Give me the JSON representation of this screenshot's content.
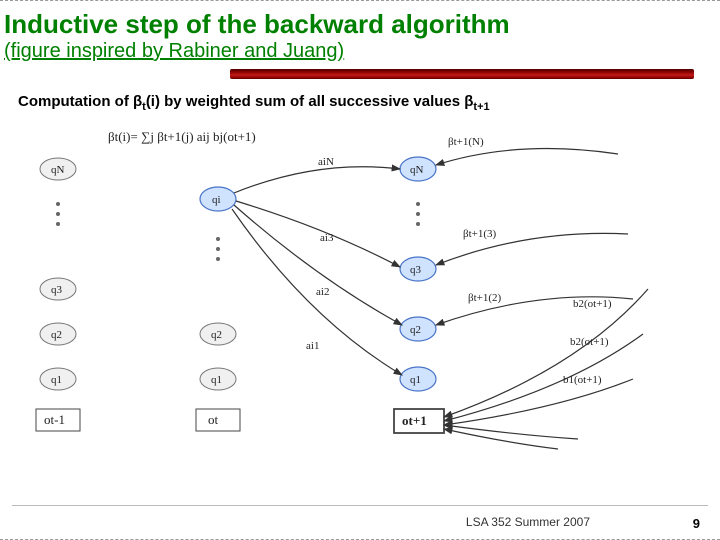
{
  "title": "Inductive step of the backward algorithm",
  "subtitle": "(figure inspired by Rabiner and Juang)",
  "caption_prefix": "Computation of β",
  "caption_sub1": "t",
  "caption_mid": "(i) by weighted sum of all successive values β",
  "caption_sub2": "t+1",
  "formula": "βt(i)= ∑j βt+1(j) aij bj(ot+1)",
  "left_nodes": [
    "qN",
    "q3",
    "q2",
    "q1"
  ],
  "mid_nodes": [
    "qi",
    "q2",
    "q1"
  ],
  "right_nodes": [
    "qN",
    "q3",
    "q2",
    "q1"
  ],
  "a_labels": [
    "aiN",
    "ai3",
    "ai2",
    "ai1"
  ],
  "beta_labels": [
    "βt+1(N)",
    "βt+1(3)",
    "βt+1(2)"
  ],
  "b_labels": [
    "b2(ot+1)",
    "b2(ot+1)",
    "b1(ot+1)"
  ],
  "obs": [
    "ot-1",
    "ot",
    "ot+1"
  ],
  "footer": "LSA 352 Summer 2007",
  "page": "9"
}
